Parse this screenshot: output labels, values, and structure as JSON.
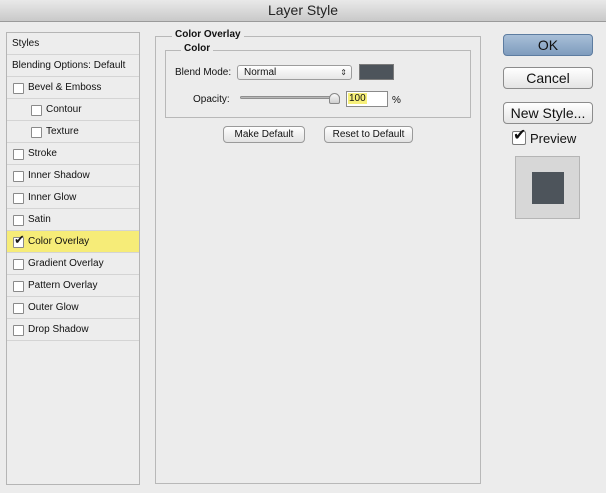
{
  "window": {
    "title": "Layer Style"
  },
  "styles_list": {
    "header": "Styles",
    "blending_options": "Blending Options: Default",
    "items": [
      {
        "label": "Bevel & Emboss",
        "checked": false
      },
      {
        "label": "Contour",
        "checked": false
      },
      {
        "label": "Texture",
        "checked": false
      },
      {
        "label": "Stroke",
        "checked": false
      },
      {
        "label": "Inner Shadow",
        "checked": false
      },
      {
        "label": "Inner Glow",
        "checked": false
      },
      {
        "label": "Satin",
        "checked": false
      },
      {
        "label": "Color Overlay",
        "checked": true
      },
      {
        "label": "Gradient Overlay",
        "checked": false
      },
      {
        "label": "Pattern Overlay",
        "checked": false
      },
      {
        "label": "Outer Glow",
        "checked": false
      },
      {
        "label": "Drop Shadow",
        "checked": false
      }
    ],
    "check_mark": "✔"
  },
  "color_overlay": {
    "section_title": "Color Overlay",
    "group_title": "Color",
    "blend_mode_label": "Blend Mode:",
    "blend_mode_value": "Normal",
    "select_arrows": "⇕",
    "overlay_color": "#4d545b",
    "opacity_label": "Opacity:",
    "opacity_value": "100",
    "opacity_unit": "%",
    "make_default": "Make Default",
    "reset_default": "Reset to Default"
  },
  "buttons": {
    "ok": "OK",
    "cancel": "Cancel",
    "new_style": "New Style...",
    "preview_label": "Preview",
    "preview_checked": true,
    "check_mark": "✔"
  },
  "colors": {
    "selection_highlight": "#f6ec78",
    "ok_button": "#8fa9c7"
  }
}
